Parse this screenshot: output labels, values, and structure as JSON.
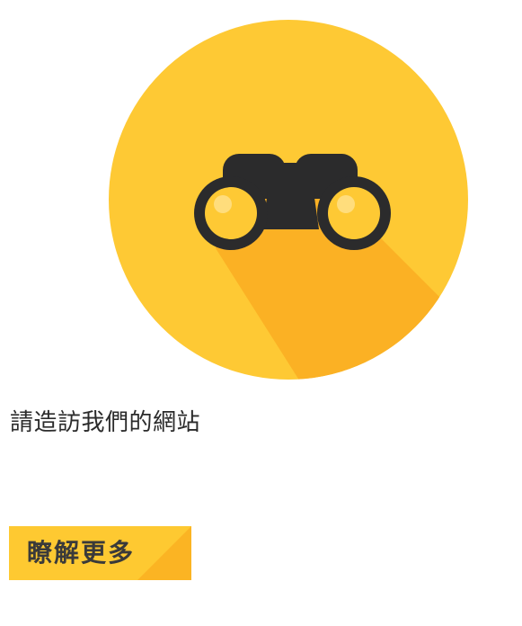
{
  "hero": {
    "icon": "binoculars-icon",
    "circle_color": "#fec934",
    "shadow_color": "#fbb124",
    "binocular_color": "#2b2b2c"
  },
  "headline": "請造訪我們的網站",
  "cta": {
    "label": "瞭解更多",
    "color": "#fec931",
    "shade_color": "#fbb423"
  }
}
